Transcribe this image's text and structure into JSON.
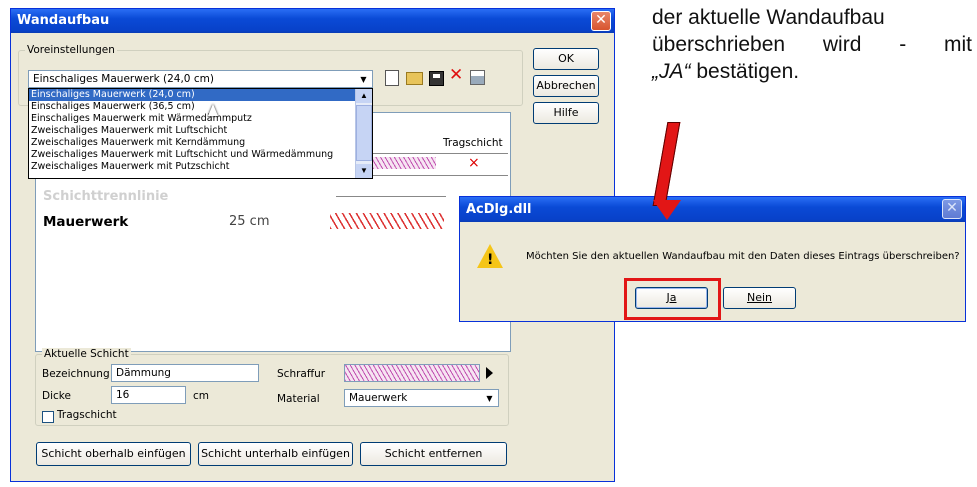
{
  "caption": {
    "line1": "der aktuelle Wandaufbau",
    "line2": "überschrieben wird - mit",
    "line3_quoted": "„JA“",
    "line3_rest": " bestätigen."
  },
  "main_dialog": {
    "title": "Wandaufbau",
    "close_glyph": "✕",
    "presets_group": "Voreinstellungen",
    "preset_selected": "Einschaliges Mauerwerk (24,0 cm)",
    "preset_options": [
      "Einschaliges Mauerwerk (24,0 cm)",
      "Einschaliges Mauerwerk (36,5 cm)",
      "Einschaliges Mauerwerk mit Wärmedämmputz",
      "Zweischaliges Mauerwerk mit Luftschicht",
      "Zweischaliges Mauerwerk mit Kerndämmung",
      "Zweischaliges Mauerwerk mit Luftschicht und Wärmedämmung",
      "Zweischaliges Mauerwerk mit Putzschicht"
    ],
    "ok_label": "OK",
    "cancel_label": "Abbrechen",
    "help_label": "Hilfe",
    "column_tragschicht": "Tragschicht",
    "layer_x_mark": "×",
    "separator_label": "Schichttrennlinie",
    "layer_name": "Mauerwerk",
    "layer_thickness": "25 cm",
    "current_layer_group": "Aktuelle Schicht",
    "label_name": "Bezeichnung",
    "value_name": "Dämmung",
    "label_thickness": "Dicke",
    "value_thickness": "16",
    "unit_cm": "cm",
    "label_hatch": "Schraffur",
    "label_material": "Material",
    "value_material": "Mauerwerk",
    "label_load_bearing": "Tragschicht",
    "btn_insert_above": "Schicht oberhalb einfügen",
    "btn_insert_below": "Schicht unterhalb einfügen",
    "btn_remove": "Schicht entfernen"
  },
  "confirm_dialog": {
    "title": "AcDlg.dll",
    "close_glyph": "✕",
    "warning_glyph": "!",
    "message": "Möchten Sie den aktuellen Wandaufbau mit den Daten dieses Eintrags überschreiben?",
    "yes_label": "Ja",
    "no_label": "Nein"
  },
  "colors": {
    "xp_title_blue": "#0a4ad6",
    "dialog_face": "#ece9d8",
    "highlight_red": "#e21616",
    "selection_blue": "#316ac5"
  }
}
